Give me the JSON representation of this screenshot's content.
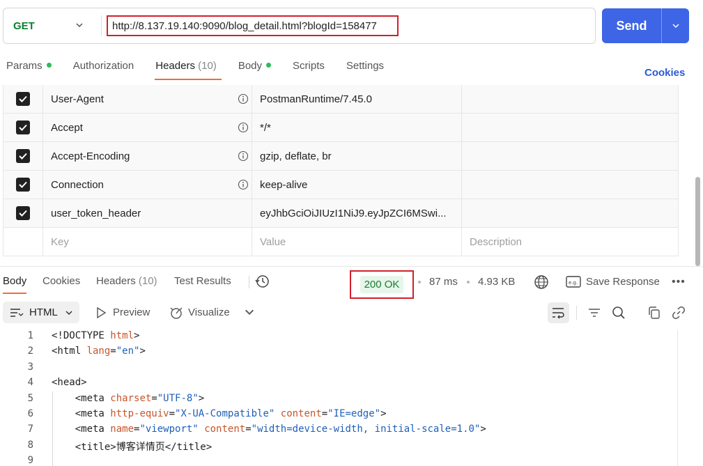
{
  "request": {
    "method": "GET",
    "url": "http://8.137.19.140:9090/blog_detail.html?blogId=158477",
    "send_label": "Send"
  },
  "request_tabs": [
    {
      "label": "Params",
      "dot": true
    },
    {
      "label": "Authorization"
    },
    {
      "label": "Headers",
      "count": "(10)",
      "active": true
    },
    {
      "label": "Body",
      "dot": true
    },
    {
      "label": "Scripts"
    },
    {
      "label": "Settings"
    }
  ],
  "cookies_label": "Cookies",
  "headers": [
    {
      "key": "User-Agent",
      "value": "PostmanRuntime/7.45.0",
      "checked": true,
      "info": true
    },
    {
      "key": "Accept",
      "value": "*/*",
      "checked": true,
      "info": true
    },
    {
      "key": "Accept-Encoding",
      "value": "gzip, deflate, br",
      "checked": true,
      "info": true
    },
    {
      "key": "Connection",
      "value": "keep-alive",
      "checked": true,
      "info": true
    },
    {
      "key": "user_token_header",
      "value": "eyJhbGciOiJIUzI1NiJ9.eyJpZCI6MSwi...",
      "checked": true,
      "info": false
    }
  ],
  "header_placeholders": {
    "key": "Key",
    "value": "Value",
    "description": "Description"
  },
  "response_tabs": [
    {
      "label": "Body",
      "active": true
    },
    {
      "label": "Cookies"
    },
    {
      "label": "Headers",
      "count": "(10)"
    },
    {
      "label": "Test Results"
    }
  ],
  "response_meta": {
    "status": "200 OK",
    "time": "87 ms",
    "size": "4.93 KB",
    "save_label": "Save Response"
  },
  "toolbar": {
    "format": "HTML",
    "preview": "Preview",
    "visualize": "Visualize"
  },
  "code_lines": [
    {
      "n": "1",
      "parts": [
        [
          "t",
          "<!DOCTYPE "
        ],
        [
          "a",
          "html"
        ],
        [
          "t",
          ">"
        ]
      ]
    },
    {
      "n": "2",
      "parts": [
        [
          "t",
          "<html "
        ],
        [
          "a",
          "lang"
        ],
        [
          "t",
          "="
        ],
        [
          "v",
          "\"en\""
        ],
        [
          "t",
          ">"
        ]
      ]
    },
    {
      "n": "3",
      "parts": []
    },
    {
      "n": "4",
      "parts": [
        [
          "t",
          "<head>"
        ]
      ]
    },
    {
      "n": "5",
      "parts": [
        [
          "t",
          "    <meta "
        ],
        [
          "a",
          "charset"
        ],
        [
          "t",
          "="
        ],
        [
          "v",
          "\"UTF-8\""
        ],
        [
          "t",
          ">"
        ]
      ]
    },
    {
      "n": "6",
      "parts": [
        [
          "t",
          "    <meta "
        ],
        [
          "a",
          "http-equiv"
        ],
        [
          "t",
          "="
        ],
        [
          "v",
          "\"X-UA-Compatible\""
        ],
        [
          "t",
          " "
        ],
        [
          "a",
          "content"
        ],
        [
          "t",
          "="
        ],
        [
          "v",
          "\"IE=edge\""
        ],
        [
          "t",
          ">"
        ]
      ]
    },
    {
      "n": "7",
      "parts": [
        [
          "t",
          "    <meta "
        ],
        [
          "a",
          "name"
        ],
        [
          "t",
          "="
        ],
        [
          "v",
          "\"viewport\""
        ],
        [
          "t",
          " "
        ],
        [
          "a",
          "content"
        ],
        [
          "t",
          "="
        ],
        [
          "v",
          "\"width=device-width, initial-scale=1.0\""
        ],
        [
          "t",
          ">"
        ]
      ]
    },
    {
      "n": "8",
      "parts": [
        [
          "t",
          "    <title>博客详情页</title>"
        ]
      ]
    },
    {
      "n": "9",
      "parts": []
    }
  ],
  "colors": {
    "accent": "#3d65e5",
    "tab_underline": "#f26b3a",
    "highlight": "#d0202a",
    "status_bg": "#e6f6ea",
    "status_fg": "#1e7b34",
    "method": "#0b7f2f"
  }
}
